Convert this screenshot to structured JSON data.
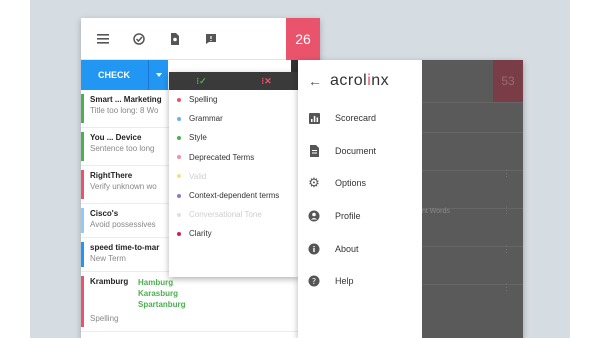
{
  "sidebar": {
    "count": "26",
    "check_label": "CHECK",
    "cards": [
      {
        "title": "Smart ... Marketing",
        "sub": "Title too long: 8 Wo",
        "color": "#4caf50"
      },
      {
        "title": "You ... Device",
        "sub": "Sentence too long",
        "color": "#4caf50"
      },
      {
        "title": "RightThere",
        "sub": "Verify unknown wo",
        "color": "#e9536b"
      },
      {
        "title": "Cisco's",
        "sub": "Avoid possessives",
        "color": "#90caf9"
      },
      {
        "title": "speed time-to-mar",
        "sub": "New Term",
        "color": "#2196f3"
      },
      {
        "title": "Kramburg",
        "suggestions": [
          "Hamburg",
          "Karasburg",
          "Spartanburg"
        ],
        "sub": "Spelling",
        "color": "#e9536b"
      }
    ]
  },
  "filter": {
    "items": [
      {
        "label": "Spelling",
        "color": "#e9536b",
        "enabled": true
      },
      {
        "label": "Grammar",
        "color": "#64b5f6",
        "enabled": true
      },
      {
        "label": "Style",
        "color": "#4caf50",
        "enabled": true
      },
      {
        "label": "Deprecated Terms",
        "color": "#f48fb1",
        "enabled": true
      },
      {
        "label": "Valid",
        "color": "#f5e08a",
        "enabled": false
      },
      {
        "label": "Context-dependent terms",
        "color": "#9575cd",
        "enabled": true
      },
      {
        "label": "Conversational Tone",
        "color": "#e0e0e0",
        "enabled": false
      },
      {
        "label": "Clarity",
        "color": "#d81b60",
        "enabled": true
      }
    ]
  },
  "app": {
    "brand_prefix": "acrol",
    "brand_accent": "i",
    "brand_suffix": "nx",
    "dim_count": "53",
    "dim_text": "nt Words",
    "menu": [
      {
        "label": "Scorecard",
        "icon": "scorecard-icon"
      },
      {
        "label": "Document",
        "icon": "document-icon"
      },
      {
        "label": "Options",
        "icon": "gear-icon"
      },
      {
        "label": "Profile",
        "icon": "profile-icon"
      },
      {
        "label": "About",
        "icon": "info-icon"
      },
      {
        "label": "Help",
        "icon": "help-icon"
      }
    ]
  }
}
